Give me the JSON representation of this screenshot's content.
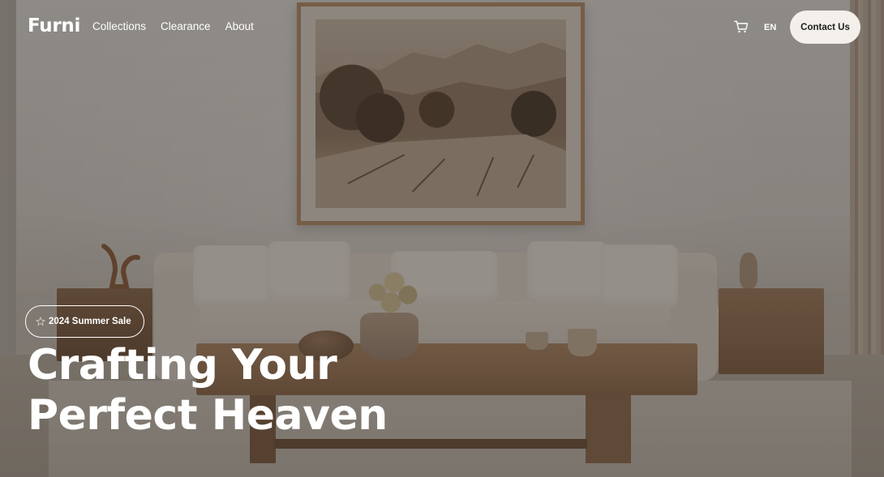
{
  "brand": {
    "name": "Furni"
  },
  "nav": {
    "links": [
      {
        "label": "Collections"
      },
      {
        "label": "Clearance"
      },
      {
        "label": "About"
      }
    ],
    "cart_icon": "shopping-cart-icon",
    "language": "EN",
    "contact_label": "Contact Us"
  },
  "hero": {
    "badge_icon": "star-icon",
    "badge_label": "2024  Summer Sale",
    "headline_line1": "Crafting Your",
    "headline_line2": "Perfect Heaven",
    "background_image": "living-room-interior-photo"
  },
  "colors": {
    "text": "#ffffff",
    "button_bg": "#f3efea",
    "button_text": "#1f1d1b",
    "overlay": "rgba(30,26,22,0.40)"
  }
}
